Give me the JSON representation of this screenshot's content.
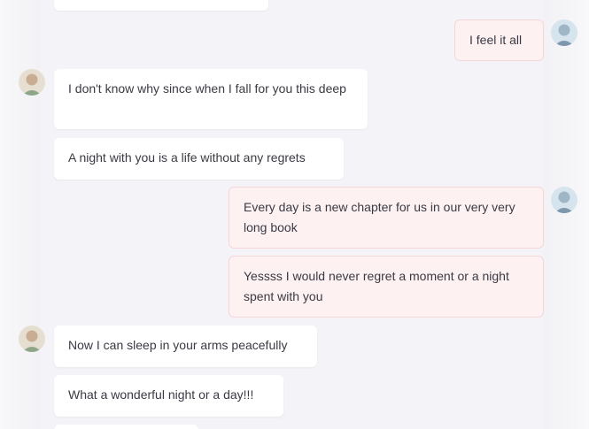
{
  "messages": [
    {
      "side": "in",
      "text": ""
    },
    {
      "side": "out",
      "text": "I feel it all"
    },
    {
      "side": "in",
      "text": "I don't know why since when I fall for you this deep"
    },
    {
      "side": "in",
      "text": "A night with you is a life without any regrets"
    },
    {
      "side": "out",
      "text": "Every day is a new chapter for us in our very very long book"
    },
    {
      "side": "out",
      "text": "Yessss I would never regret a moment or a night spent with you"
    },
    {
      "side": "in",
      "text": "Now I can sleep in your arms peacefully"
    },
    {
      "side": "in",
      "text": "What a wonderful night or a day!!!"
    },
    {
      "side": "in",
      "text": ""
    }
  ],
  "avatars": {
    "contact": "contact-avatar-photo",
    "self": "self-avatar-photo"
  },
  "colors": {
    "background": "#f4f4f8",
    "incoming_bubble": "#ffffff",
    "outgoing_bubble": "#fdf1f2",
    "outgoing_border": "#f6d6d9",
    "text": "#3a3a44"
  }
}
